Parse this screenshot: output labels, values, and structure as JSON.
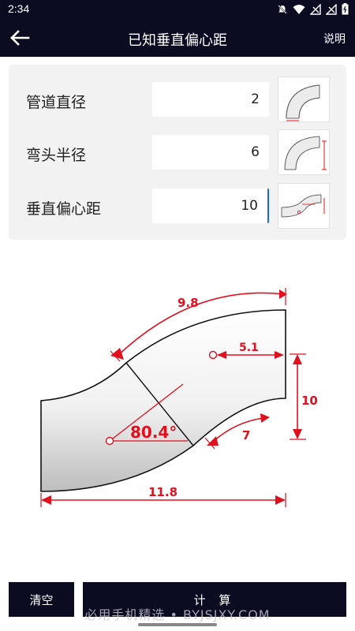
{
  "status": {
    "time": "2:34",
    "icons": [
      "mute-icon",
      "wifi-icon",
      "signal-off-icon",
      "signal-off-icon",
      "battery-icon"
    ]
  },
  "appbar": {
    "title": "已知垂直偏心距",
    "help": "说明"
  },
  "form": {
    "rows": [
      {
        "label": "管道直径",
        "value": "2",
        "thumb": "pipe-diameter-thumb"
      },
      {
        "label": "弯头半径",
        "value": "6",
        "thumb": "bend-radius-thumb"
      },
      {
        "label": "垂直偏心距",
        "value": "10",
        "thumb": "vertical-offset-thumb"
      }
    ]
  },
  "diagram": {
    "top_length": "9.8",
    "radius_offset": "5.1",
    "vertical_offset": "10",
    "inner_length": "7",
    "angle": "80.4°",
    "bottom_length": "11.8"
  },
  "buttons": {
    "clear": "清空",
    "calculate": "计 算"
  },
  "watermark": "必用手机精选 • BYJSJXY.COM",
  "colors": {
    "bar": "#0b0b22",
    "dimension": "#e0101e",
    "card": "#f2f2f2"
  }
}
